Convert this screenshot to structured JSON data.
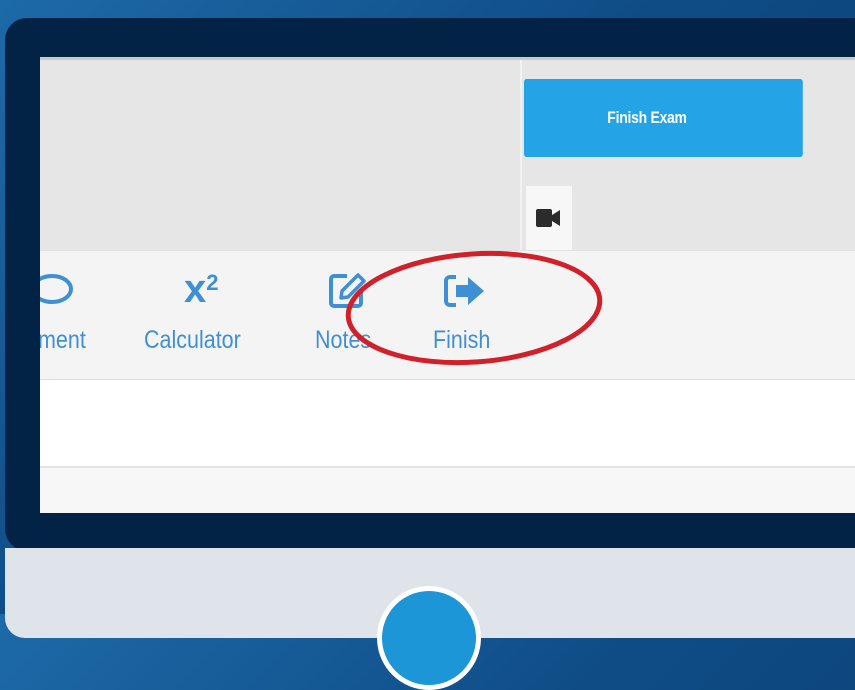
{
  "header": {
    "finish_exam_label": "Finish Exam",
    "camera_icon": "video-camera-icon"
  },
  "toolbar": {
    "items": [
      {
        "label": "ment",
        "icon": "comment-icon"
      },
      {
        "label": "Calculator",
        "icon": "superscript-x2-icon"
      },
      {
        "label": "Notes",
        "icon": "edit-note-icon"
      },
      {
        "label": "Finish",
        "icon": "sign-out-icon"
      }
    ],
    "calculator_glyph": "x",
    "calculator_superscript": "2"
  },
  "annotation": {
    "highlight": "Finish",
    "color": "#d0202a"
  },
  "colors": {
    "accent": "#24a3e6",
    "toolbar_text": "#3f8fd4",
    "bezel": "#022246",
    "background": "#0f4c86"
  }
}
